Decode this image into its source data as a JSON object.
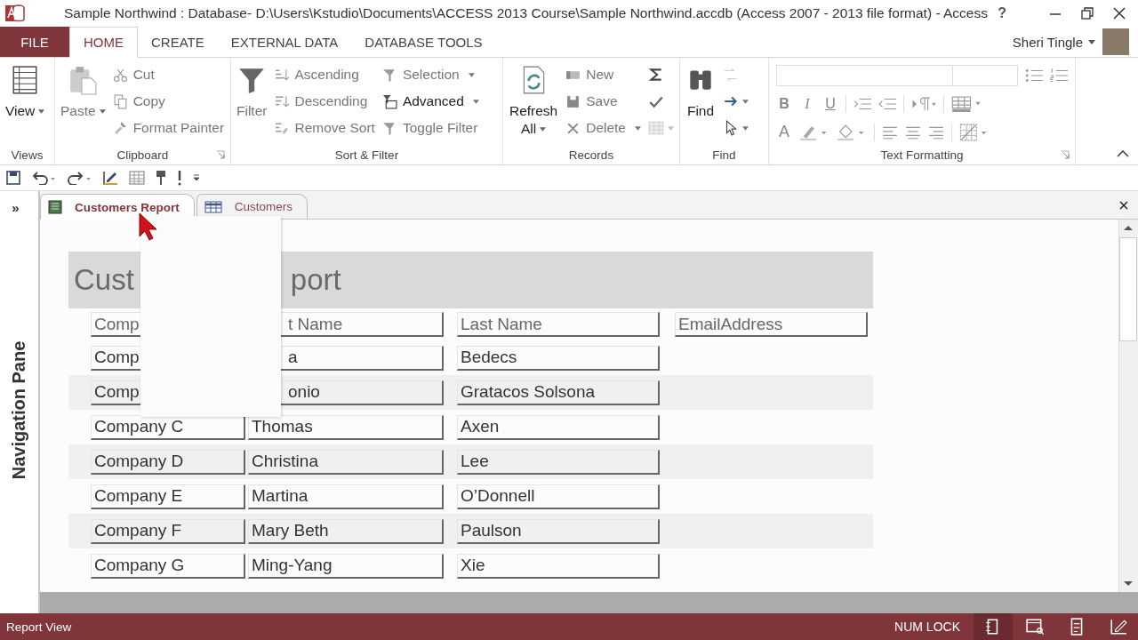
{
  "window": {
    "title": "Sample Northwind : Database- D:\\Users\\Kstudio\\Documents\\ACCESS 2013 Course\\Sample Northwind.accdb (Access 2007 - 2013 file format) - Access",
    "help": "?"
  },
  "ribbon_tabs": [
    {
      "label": "FILE",
      "kind": "file",
      "selected": false
    },
    {
      "label": "HOME",
      "kind": "tab",
      "selected": true
    },
    {
      "label": "CREATE",
      "kind": "tab",
      "selected": false
    },
    {
      "label": "EXTERNAL DATA",
      "kind": "tab",
      "selected": false
    },
    {
      "label": "DATABASE TOOLS",
      "kind": "tab",
      "selected": false
    }
  ],
  "user": {
    "name": "Sheri Tingle"
  },
  "ribbon": {
    "groups": [
      {
        "label": "Views",
        "kind": "commands",
        "launcher": false,
        "columns": [
          [
            {
              "label": "View",
              "kind": "large",
              "dropdown": true,
              "disabled": false
            }
          ]
        ]
      },
      {
        "label": "Clipboard",
        "kind": "commands",
        "launcher": true,
        "columns": [
          [
            {
              "label": "Paste",
              "kind": "large",
              "dropdown": true,
              "disabled": true
            }
          ],
          [
            {
              "label": "Cut",
              "kind": "small",
              "dropdown": false,
              "disabled": true
            },
            {
              "label": "Copy",
              "kind": "small",
              "dropdown": false,
              "disabled": true
            },
            {
              "label": "Format Painter",
              "kind": "small",
              "dropdown": false,
              "disabled": true
            }
          ]
        ]
      },
      {
        "label": "Sort & Filter",
        "kind": "commands",
        "launcher": false,
        "columns": [
          [
            {
              "label": "Filter",
              "kind": "large",
              "dropdown": false,
              "disabled": true
            }
          ],
          [
            {
              "label": "Ascending",
              "kind": "small",
              "dropdown": false,
              "disabled": true
            },
            {
              "label": "Descending",
              "kind": "small",
              "dropdown": false,
              "disabled": true
            },
            {
              "label": "Remove Sort",
              "kind": "small",
              "dropdown": false,
              "disabled": true
            }
          ],
          [
            {
              "label": "Selection",
              "kind": "small",
              "dropdown": true,
              "disabled": true
            },
            {
              "label": "Advanced",
              "kind": "small",
              "dropdown": true,
              "disabled": false
            },
            {
              "label": "Toggle Filter",
              "kind": "small",
              "dropdown": false,
              "disabled": true
            }
          ]
        ]
      },
      {
        "label": "Records",
        "kind": "commands",
        "launcher": false,
        "columns": [
          [
            {
              "label": "Refresh All",
              "kind": "large",
              "dropdown": true,
              "disabled": false
            }
          ],
          [
            {
              "label": "New",
              "kind": "small",
              "dropdown": false,
              "disabled": true
            },
            {
              "label": "Save",
              "kind": "small",
              "dropdown": false,
              "disabled": true
            },
            {
              "label": "Delete",
              "kind": "small",
              "dropdown": true,
              "disabled": true
            }
          ],
          [
            {
              "kind": "icon",
              "dropdown": false,
              "disabled": false
            },
            {
              "kind": "icon",
              "dropdown": false,
              "disabled": false
            },
            {
              "kind": "icon",
              "dropdown": true,
              "disabled": true
            }
          ]
        ]
      },
      {
        "label": "Find",
        "kind": "commands",
        "launcher": false,
        "columns": [
          [
            {
              "label": "Find",
              "kind": "large",
              "dropdown": false,
              "disabled": false
            }
          ],
          [
            {
              "kind": "icon",
              "dropdown": false,
              "disabled": true
            },
            {
              "kind": "icon",
              "dropdown": true,
              "disabled": false
            },
            {
              "kind": "icon",
              "dropdown": true,
              "disabled": false
            }
          ]
        ]
      },
      {
        "label": "Text Formatting",
        "kind": "text_formatting",
        "launcher": true,
        "toggles": [
          "B",
          "I",
          "U"
        ],
        "font_color": "A"
      }
    ]
  },
  "document_tabs": [
    {
      "label": "Customers Report",
      "kind": "report",
      "selected": true
    },
    {
      "label": "Customers",
      "kind": "table",
      "selected": false
    }
  ],
  "navigation_pane": {
    "label": "Navigation Pane",
    "expand_glyph": "»"
  },
  "report": {
    "title_parts": [
      "Cust",
      "port"
    ],
    "popup_visible": true,
    "header": {
      "covered": true,
      "cells": [
        "Comp",
        "t Name",
        "Last Name",
        "EmailAddress"
      ]
    },
    "rows": [
      {
        "company": "Comp",
        "first_name": "a",
        "last_name": "Bedecs",
        "shaded": false,
        "covered": true
      },
      {
        "company": "Comp",
        "first_name": "onio",
        "last_name": "Gratacos Solsona",
        "shaded": true,
        "covered": true
      },
      {
        "company": "Company C",
        "first_name": "Thomas",
        "last_name": "Axen",
        "shaded": false,
        "covered": false
      },
      {
        "company": "Company D",
        "first_name": "Christina",
        "last_name": "Lee",
        "shaded": true,
        "covered": false
      },
      {
        "company": "Company E",
        "first_name": "Martina",
        "last_name": "O’Donnell",
        "shaded": false,
        "covered": false
      },
      {
        "company": "Company F",
        "first_name": "Mary Beth",
        "last_name": "Paulson",
        "shaded": true,
        "covered": false
      },
      {
        "company": "Company G",
        "first_name": "Ming-Yang",
        "last_name": "Xie",
        "shaded": false,
        "covered": false
      }
    ]
  },
  "status_bar": {
    "mode": "Report View",
    "indicator": "NUM LOCK",
    "views": [
      {
        "selected": true
      },
      {
        "selected": false
      },
      {
        "selected": false
      },
      {
        "selected": false
      }
    ]
  }
}
